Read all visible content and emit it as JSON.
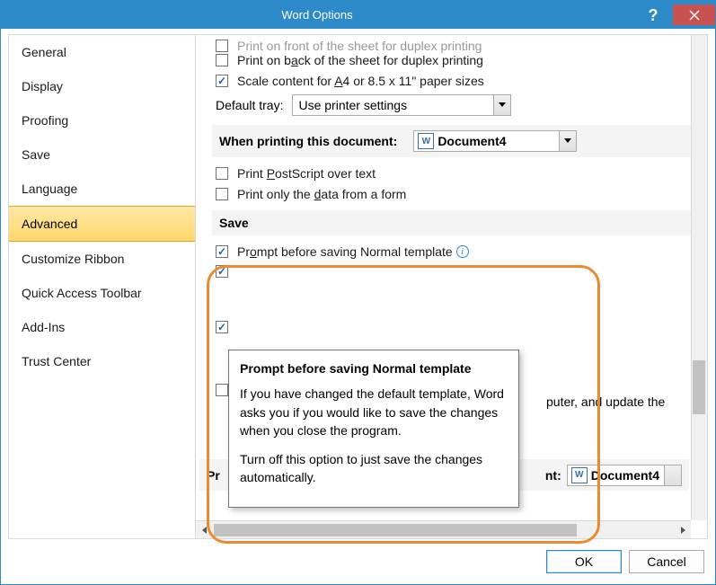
{
  "window": {
    "title": "Word Options"
  },
  "sidebar": {
    "items": [
      "General",
      "Display",
      "Proofing",
      "Save",
      "Language",
      "Advanced",
      "Customize Ribbon",
      "Quick Access Toolbar",
      "Add-Ins",
      "Trust Center"
    ],
    "selected_index": 5
  },
  "content": {
    "partial_top": "Print on front of the sheet for duplex printing",
    "opt_back": "Print on back of the sheet for duplex printing",
    "opt_scale": "Scale content for A4 or 8.5 x 11\" paper sizes",
    "tray_label": "Default tray:",
    "tray_value": "Use printer settings",
    "section_printing": "When printing this document:",
    "doc_name": "Document4",
    "opt_postscript": "Print PostScript over text",
    "opt_dataonly": "Print only the data from a form",
    "section_save": "Save",
    "opt_prompt": "Prompt before saving Normal template",
    "clipped_right": "puter, and update the",
    "section_preserve_prefix": "Pr",
    "section_preserve_suffix": "nt:",
    "doc_name2": "Document4"
  },
  "tooltip": {
    "title": "Prompt before saving Normal template",
    "p1": "If you have changed the default template, Word asks you if you would like to save the changes when you close the program.",
    "p2": "Turn off this option to just save the changes automatically."
  },
  "buttons": {
    "ok": "OK",
    "cancel": "Cancel"
  }
}
